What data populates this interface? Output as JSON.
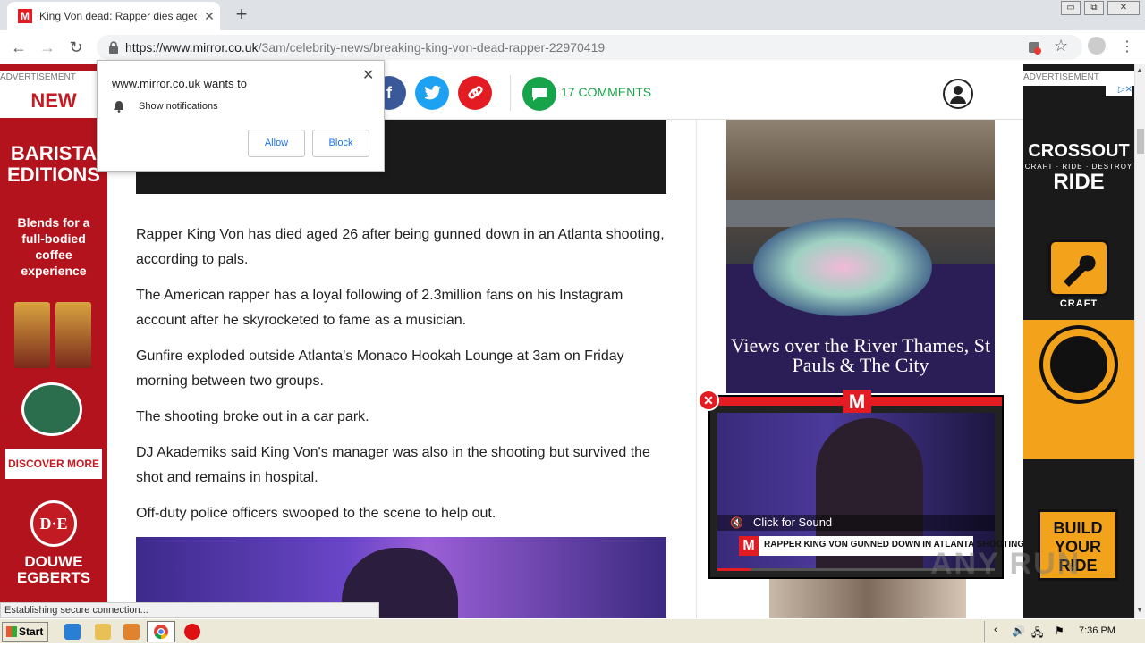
{
  "browser": {
    "tab_title": "King Von dead: Rapper dies aged 26",
    "tab_close": "✕",
    "new_tab": "+",
    "url_prefix": "https://www.mirror.co.uk",
    "url_path": "/3am/celebrity-news/breaking-king-von-dead-rapper-22970419",
    "window_controls": [
      "▭",
      "⧉",
      "✕"
    ]
  },
  "notification_prompt": {
    "title": "www.mirror.co.uk wants to",
    "permission": "Show notifications",
    "allow": "Allow",
    "block": "Block",
    "close": "✕"
  },
  "left_ad": {
    "label": "ADVERTISEMENT",
    "badge": "NEW",
    "title_lines": "BARISTA EDITIONS",
    "subtitle": "Blends for a full-bodied coffee experience",
    "cta": "DISCOVER MORE",
    "logo": "D·E",
    "brand": "DOUWE EGBERTS"
  },
  "article_header": {
    "comments_label": "17 COMMENTS",
    "share_buttons": [
      "facebook-icon",
      "twitter-icon",
      "link-icon"
    ]
  },
  "article": {
    "paragraphs": [
      "Rapper King Von has died aged 26 after being gunned down in an Atlanta shooting, according to pals.",
      "The American rapper has a loyal following of 2.3million fans on his Instagram account after he skyrocketed to fame as a musician.",
      "Gunfire exploded outside Atlanta's Monaco Hookah Lounge at 3am on Friday morning between two groups.",
      "The shooting broke out in a car park.",
      "DJ Akademiks said King Von's manager was also in the shooting but survived the shot and remains in hospital.",
      "Off-duty police officers swooped to the scene to help out."
    ]
  },
  "sidebar_ad": {
    "caption": "Views over the River Thames, St Pauls & The City"
  },
  "video": {
    "logo": "M",
    "close": "✕",
    "sound_label": "Click for Sound",
    "ticker": "RAPPER KING VON GUNNED DOWN IN ATLANTA SHOOTING",
    "progress": 0.12
  },
  "right_ad": {
    "label": "ADVERTISEMENT",
    "title": "CROSSOUT",
    "tagline": "CRAFT · RIDE · DESTROY",
    "craft": "CRAFT",
    "ride": "RIDE",
    "build": "BUILD YOUR RIDE"
  },
  "status_text": "Establishing secure connection...",
  "watermark": "ANY RUN",
  "taskbar": {
    "start": "Start",
    "clock": "7:36 PM"
  }
}
